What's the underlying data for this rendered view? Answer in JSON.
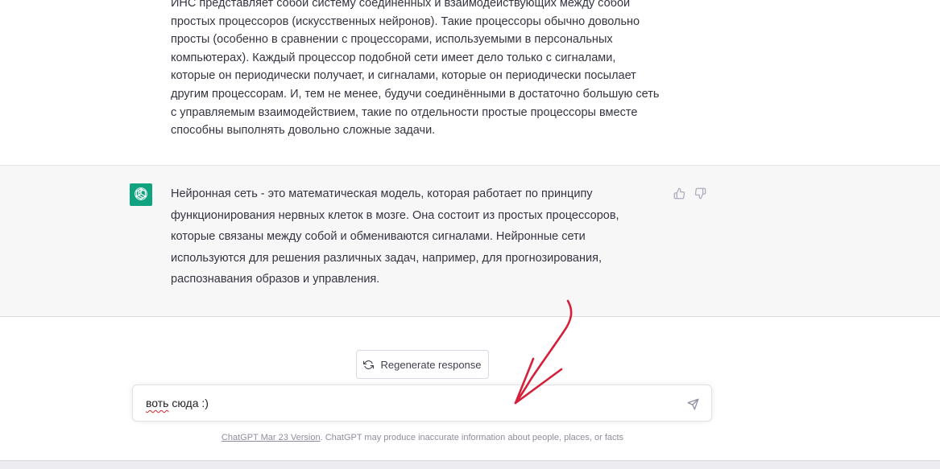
{
  "conversation": {
    "user_message": "ИНС представляет собой систему соединённых и взаимодействующих между собой простых процессоров (искусственных нейронов). Такие процессоры обычно довольно просты (особенно в сравнении с процессорами, используемыми в персональных компьютерах). Каждый процессор подобной сети имеет дело только с сигналами, которые он периодически получает, и сигналами, которые он периодически посылает другим процессорам. И, тем не менее, будучи соединёнными в достаточно большую сеть с управляемым взаимодействием, такие по отдельности простые процессоры вместе способны выполнять довольно сложные задачи.",
    "assistant_message": "Нейронная сеть - это математическая модель, которая работает по принципу функционирования нервных клеток в мозге. Она состоит из простых процессоров, которые связаны между собой и обмениваются сигналами. Нейронные сети используются для решения различных задач, например, для прогнозирования, распознавания образов и управления."
  },
  "regenerate": {
    "label": "Regenerate response"
  },
  "composer": {
    "word_misspelled": "воть",
    "word_rest": " сюда :)"
  },
  "footer": {
    "version_link": "ChatGPT Mar 23 Version",
    "disclaimer": ". ChatGPT may produce inaccurate information about people, places, or facts"
  },
  "colors": {
    "brand_green": "#10a37f",
    "assistant_bg": "#f7f7f8",
    "annotation_red": "#d4203a"
  },
  "icons": {
    "avatar": "openai-logo-icon",
    "like": "thumbs-up-icon",
    "dislike": "thumbs-down-icon",
    "regenerate": "refresh-icon",
    "send": "paper-plane-icon"
  }
}
